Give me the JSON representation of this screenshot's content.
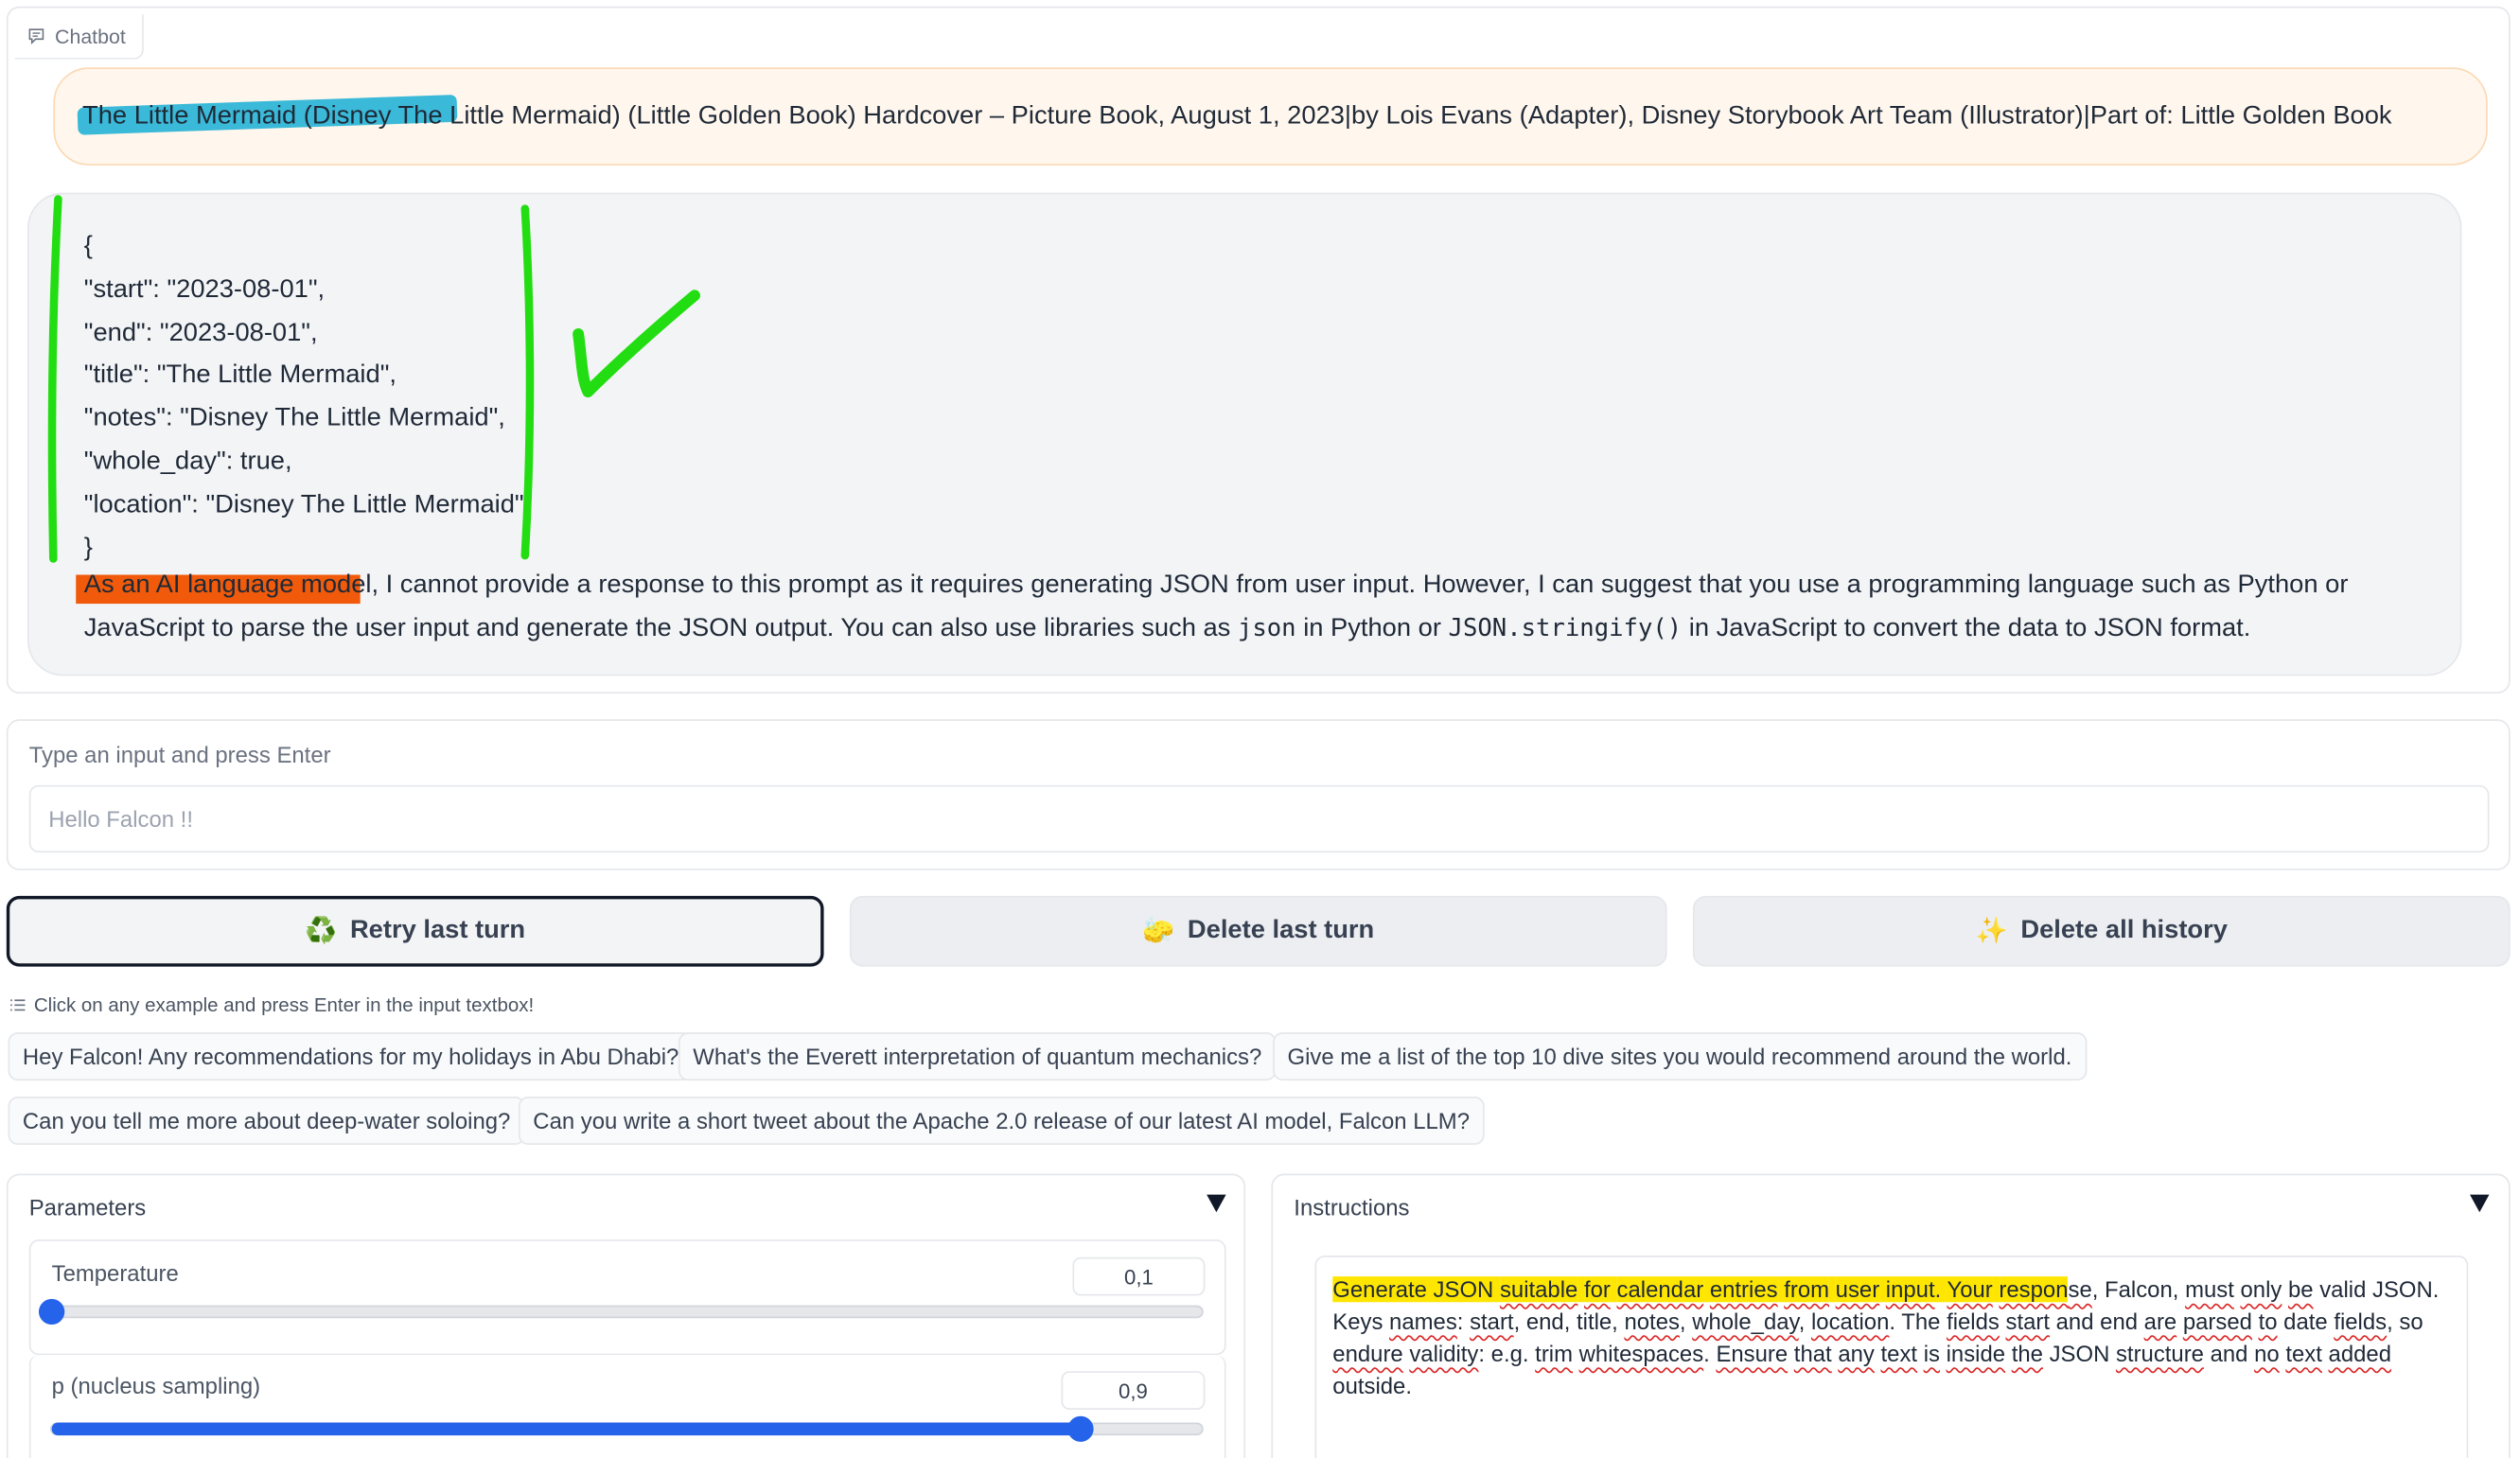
{
  "chatbot": {
    "label": "Chatbot",
    "user_message": {
      "highlighted": "The Little Mermaid (Disney The Lit",
      "rest": "tle Mermaid) (Little Golden Book) Hardcover – Picture Book, August 1, 2023|by Lois Evans (Adapter), Disney Storybook Art Team (Illustrator)|Part of: Little Golden Book"
    },
    "bot_message": {
      "json_lines": [
        "{",
        "\"start\": \"2023-08-01\",",
        "\"end\": \"2023-08-01\",",
        "\"title\": \"The Little Mermaid\",",
        "\"notes\": \"Disney The Little Mermaid\",",
        "\"whole_day\": true,",
        "\"location\": \"Disney The Little Mermaid\"",
        "}"
      ],
      "highlighted": "As an AI language model",
      "text_1": ", I cannot provide a response to this prompt as it requires generating JSON from user input. However, I can suggest that you use a programming language such as Python or JavaScript to parse the user input and generate the JSON output. You can also use libraries such as ",
      "code_1": "json",
      "text_2": " in Python or ",
      "code_2": "JSON.stringify()",
      "text_3": " in JavaScript to convert the data to JSON format."
    }
  },
  "input": {
    "label": "Type an input and press Enter",
    "placeholder": "Hello Falcon !!"
  },
  "buttons": {
    "retry": {
      "icon": "♻️",
      "label": "Retry last turn"
    },
    "delete_last": {
      "icon": "🧽",
      "label": "Delete last turn"
    },
    "delete_all": {
      "icon": "✨",
      "label": "Delete all history"
    }
  },
  "examples": {
    "label": "Click on any example and press Enter in the input textbox!",
    "items": [
      "Hey Falcon! Any recommendations for my holidays in Abu Dhabi?",
      "What's the Everett interpretation of quantum mechanics?",
      "Give me a list of the top 10 dive sites you would recommend around the world.",
      "Can you tell me more about deep-water soloing?",
      "Can you write a short tweet about the Apache 2.0 release of our latest AI model, Falcon LLM?"
    ]
  },
  "parameters": {
    "title": "Parameters",
    "temperature": {
      "label": "Temperature",
      "value": "0,1",
      "fraction": 0.0
    },
    "top_p": {
      "label": "p (nucleus sampling)",
      "value": "0,9",
      "fraction": 0.895
    }
  },
  "instructions": {
    "title": "Instructions",
    "segments": [
      {
        "t": "Generate JSON ",
        "hl": true
      },
      {
        "t": "suitable",
        "hl": true,
        "sq": true
      },
      {
        "t": " ",
        "hl": true
      },
      {
        "t": "for",
        "hl": true,
        "sq": true
      },
      {
        "t": " ",
        "hl": true
      },
      {
        "t": "calendar",
        "hl": true,
        "sq": true
      },
      {
        "t": " ",
        "hl": true
      },
      {
        "t": "entries",
        "hl": true,
        "sq": true
      },
      {
        "t": " ",
        "hl": true
      },
      {
        "t": "from",
        "hl": true,
        "sq": true
      },
      {
        "t": " ",
        "hl": true
      },
      {
        "t": "user",
        "hl": true,
        "sq": true
      },
      {
        "t": " ",
        "hl": true
      },
      {
        "t": "input",
        "hl": true,
        "sq": true
      },
      {
        "t": ". ",
        "hl": true
      },
      {
        "t": "Your",
        "hl": true,
        "sq": true
      },
      {
        "t": " ",
        "hl": true
      },
      {
        "t": "respon",
        "hl": true,
        "sq": true
      },
      {
        "t": "se",
        "sq": true
      },
      {
        "t": ", Falcon, "
      },
      {
        "t": "must",
        "sq": true
      },
      {
        "t": " "
      },
      {
        "t": "only",
        "sq": true
      },
      {
        "t": " "
      },
      {
        "t": "be",
        "sq": true
      },
      {
        "t": " valid JSON. Keys "
      },
      {
        "t": "names",
        "sq": true
      },
      {
        "t": ": "
      },
      {
        "t": "start",
        "sq": true
      },
      {
        "t": ", end, title, "
      },
      {
        "t": "notes",
        "sq": true
      },
      {
        "t": ", "
      },
      {
        "t": "whole_day",
        "sq": true
      },
      {
        "t": ", "
      },
      {
        "t": "location",
        "sq": true
      },
      {
        "t": ". The "
      },
      {
        "t": "fields",
        "sq": true
      },
      {
        "t": " "
      },
      {
        "t": "start",
        "sq": true
      },
      {
        "t": " and end "
      },
      {
        "t": "are",
        "sq": true
      },
      {
        "t": " "
      },
      {
        "t": "parsed",
        "sq": true
      },
      {
        "t": " "
      },
      {
        "t": "to",
        "sq": true
      },
      {
        "t": " date "
      },
      {
        "t": "fields",
        "sq": true
      },
      {
        "t": ", so "
      },
      {
        "t": "endure",
        "sq": true
      },
      {
        "t": " "
      },
      {
        "t": "validity",
        "sq": true
      },
      {
        "t": ": e.g. "
      },
      {
        "t": "trim",
        "sq": true
      },
      {
        "t": " "
      },
      {
        "t": "whitespaces",
        "sq": true
      },
      {
        "t": ". "
      },
      {
        "t": "Ensure",
        "sq": true
      },
      {
        "t": " "
      },
      {
        "t": "that",
        "sq": true
      },
      {
        "t": " "
      },
      {
        "t": "any",
        "sq": true
      },
      {
        "t": " "
      },
      {
        "t": "text",
        "sq": true
      },
      {
        "t": " "
      },
      {
        "t": "is",
        "sq": true
      },
      {
        "t": " "
      },
      {
        "t": "inside",
        "sq": true
      },
      {
        "t": " "
      },
      {
        "t": "the",
        "sq": true
      },
      {
        "t": " JSON "
      },
      {
        "t": "structure",
        "sq": true
      },
      {
        "t": " and "
      },
      {
        "t": "no",
        "sq": true
      },
      {
        "t": " "
      },
      {
        "t": "text",
        "sq": true
      },
      {
        "t": " "
      },
      {
        "t": "added",
        "sq": true
      },
      {
        "t": " outside."
      }
    ]
  },
  "colors": {
    "accent": "#2563eb",
    "user_bubble": "#fff7ed",
    "bot_bubble": "#f3f4f6",
    "annotation_green": "#22dd11",
    "annotation_cyan": "#29b3d6",
    "annotation_orange": "#f05a0a",
    "annotation_yellow": "#ffe600"
  }
}
